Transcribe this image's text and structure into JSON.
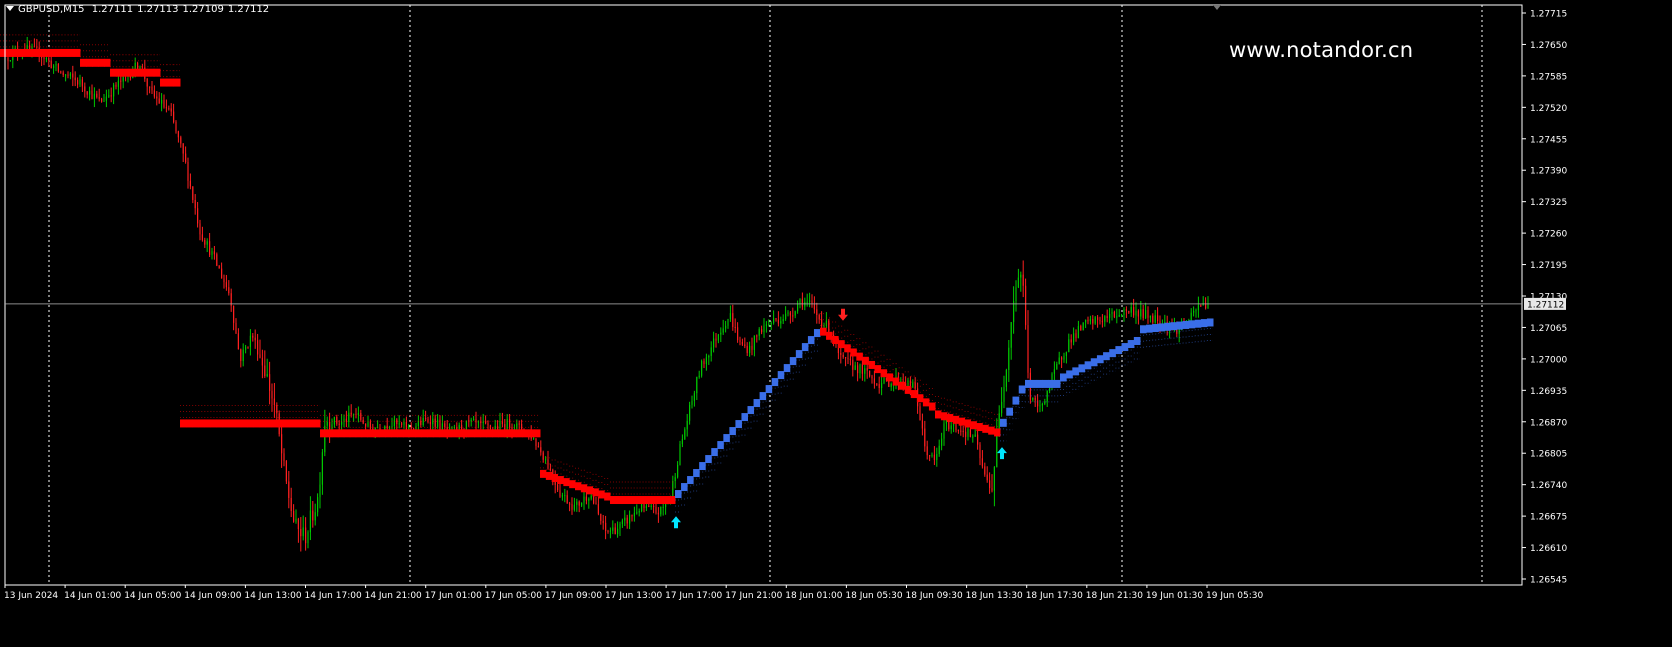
{
  "header": {
    "symbol": "GBPUSD,M15",
    "open": "1.27111",
    "high": "1.27113",
    "low": "1.27109",
    "close": "1.27112"
  },
  "watermark": "www.notandor.cn",
  "colors": {
    "background": "#000000",
    "bull_candle": "#00c800",
    "bear_candle": "#ff2020",
    "trend_down": "#ff0000",
    "trend_up": "#3a6ee8",
    "signal_up_arrow": "#00e5ff",
    "signal_down_arrow": "#ff2020",
    "grid": "#ffffff",
    "axis_text": "#ffffff"
  },
  "chart_data": {
    "type": "candlestick",
    "symbol": "GBPUSD",
    "timeframe": "M15",
    "current_price": "1.27112",
    "ylim": [
      1.26545,
      1.27715
    ],
    "y_ticks": [
      "1.27715",
      "1.27650",
      "1.27585",
      "1.27520",
      "1.27455",
      "1.27390",
      "1.27325",
      "1.27260",
      "1.27195",
      "1.27130",
      "1.27065",
      "1.27000",
      "1.26935",
      "1.26870",
      "1.26805",
      "1.26740",
      "1.26675",
      "1.26610",
      "1.26545"
    ],
    "x_ticks": [
      "13 Jun 2024",
      "14 Jun 01:00",
      "14 Jun 05:00",
      "14 Jun 09:00",
      "14 Jun 13:00",
      "14 Jun 17:00",
      "14 Jun 21:00",
      "17 Jun 01:00",
      "17 Jun 05:00",
      "17 Jun 09:00",
      "17 Jun 13:00",
      "17 Jun 17:00",
      "17 Jun 21:00",
      "18 Jun 01:00",
      "18 Jun 05:30",
      "18 Jun 09:30",
      "18 Jun 13:30",
      "18 Jun 17:30",
      "18 Jun 21:30",
      "19 Jun 01:30",
      "19 Jun 05:30"
    ],
    "grid": "dotted vertical at day separators",
    "price_path": [
      [
        0,
        1.276
      ],
      [
        20,
        1.2763
      ],
      [
        40,
        1.2762
      ],
      [
        60,
        1.2758
      ],
      [
        80,
        1.2756
      ],
      [
        100,
        1.2752
      ],
      [
        120,
        1.2756
      ],
      [
        140,
        1.276
      ],
      [
        150,
        1.2754
      ],
      [
        170,
        1.275
      ],
      [
        185,
        1.274
      ],
      [
        200,
        1.2726
      ],
      [
        215,
        1.272
      ],
      [
        230,
        1.2713
      ],
      [
        240,
        1.27
      ],
      [
        252,
        1.2705
      ],
      [
        265,
        1.2698
      ],
      [
        275,
        1.269
      ],
      [
        285,
        1.2676
      ],
      [
        295,
        1.2666
      ],
      [
        305,
        1.2664
      ],
      [
        318,
        1.2672
      ],
      [
        325,
        1.2688
      ],
      [
        340,
        1.2687
      ],
      [
        355,
        1.2689
      ],
      [
        370,
        1.2686
      ],
      [
        390,
        1.2687
      ],
      [
        410,
        1.2686
      ],
      [
        430,
        1.2688
      ],
      [
        450,
        1.2685
      ],
      [
        470,
        1.2687
      ],
      [
        490,
        1.2686
      ],
      [
        510,
        1.2687
      ],
      [
        530,
        1.2685
      ],
      [
        545,
        1.268
      ],
      [
        560,
        1.2673
      ],
      [
        575,
        1.267
      ],
      [
        590,
        1.2673
      ],
      [
        605,
        1.2665
      ],
      [
        620,
        1.2666
      ],
      [
        640,
        1.267
      ],
      [
        660,
        1.2669
      ],
      [
        670,
        1.2672
      ],
      [
        680,
        1.2682
      ],
      [
        690,
        1.269
      ],
      [
        700,
        1.2698
      ],
      [
        710,
        1.2702
      ],
      [
        720,
        1.2706
      ],
      [
        730,
        1.2709
      ],
      [
        740,
        1.2703
      ],
      [
        750,
        1.2702
      ],
      [
        760,
        1.2706
      ],
      [
        775,
        1.2708
      ],
      [
        790,
        1.2709
      ],
      [
        800,
        1.2712
      ],
      [
        810,
        1.2711
      ],
      [
        820,
        1.2708
      ],
      [
        830,
        1.2706
      ],
      [
        840,
        1.27
      ],
      [
        860,
        1.2698
      ],
      [
        880,
        1.2695
      ],
      [
        900,
        1.2696
      ],
      [
        915,
        1.2694
      ],
      [
        925,
        1.2682
      ],
      [
        935,
        1.2679
      ],
      [
        945,
        1.2687
      ],
      [
        960,
        1.2686
      ],
      [
        975,
        1.2684
      ],
      [
        985,
        1.2676
      ],
      [
        992,
        1.2674
      ],
      [
        1000,
        1.269
      ],
      [
        1008,
        1.2702
      ],
      [
        1015,
        1.2715
      ],
      [
        1022,
        1.2718
      ],
      [
        1030,
        1.2692
      ],
      [
        1040,
        1.269
      ],
      [
        1050,
        1.2695
      ],
      [
        1060,
        1.27
      ],
      [
        1070,
        1.2704
      ],
      [
        1085,
        1.2707
      ],
      [
        1100,
        1.2708
      ],
      [
        1115,
        1.2709
      ],
      [
        1130,
        1.271
      ],
      [
        1145,
        1.2709
      ],
      [
        1160,
        1.2708
      ],
      [
        1175,
        1.2706
      ],
      [
        1190,
        1.2708
      ],
      [
        1200,
        1.2711
      ],
      [
        1210,
        1.27112
      ]
    ],
    "trend_line": [
      {
        "from": 0,
        "to": 80,
        "value": 1.2762,
        "dir": "down"
      },
      {
        "from": 80,
        "to": 110,
        "value": 1.276,
        "dir": "down"
      },
      {
        "from": 110,
        "to": 160,
        "value": 1.2758,
        "dir": "down"
      },
      {
        "from": 160,
        "to": 180,
        "value": 1.2756,
        "dir": "down"
      },
      {
        "from": 180,
        "to": 320,
        "value": 1.2687,
        "dir": "down",
        "slope_to": 1.2687
      },
      {
        "from": 320,
        "to": 540,
        "value": 1.2685,
        "dir": "down"
      },
      {
        "from": 540,
        "to": 610,
        "value": 1.2677,
        "dir": "down",
        "slope_to": 1.2672
      },
      {
        "from": 610,
        "to": 675,
        "value": 1.26715,
        "dir": "down"
      },
      {
        "from": 675,
        "to": 820,
        "value": 1.2672,
        "dir": "up",
        "slope_to": 1.2706
      },
      {
        "from": 820,
        "to": 935,
        "value": 1.2706,
        "dir": "down",
        "slope_to": 1.269
      },
      {
        "from": 935,
        "to": 1000,
        "value": 1.2689,
        "dir": "down",
        "slope_to": 1.2685
      },
      {
        "from": 1000,
        "to": 1025,
        "value": 1.2686,
        "dir": "up",
        "slope_to": 1.2695
      },
      {
        "from": 1025,
        "to": 1060,
        "value": 1.2695,
        "dir": "up"
      },
      {
        "from": 1060,
        "to": 1140,
        "value": 1.2696,
        "dir": "up",
        "slope_to": 1.2704
      },
      {
        "from": 1140,
        "to": 1213,
        "value": 1.2706,
        "dir": "up",
        "slope_to": 1.27075
      }
    ],
    "signals": [
      {
        "x": 676,
        "price": 1.2667,
        "dir": "up"
      },
      {
        "x": 843,
        "price": 1.2709,
        "dir": "down"
      },
      {
        "x": 1002,
        "price": 1.2681,
        "dir": "up"
      }
    ]
  }
}
